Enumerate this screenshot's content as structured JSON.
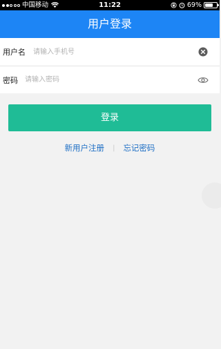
{
  "status_bar": {
    "carrier": "中国移动",
    "time": "11:22",
    "battery": "69%",
    "battery_level": 0.69,
    "icons": [
      "signal-dots",
      "wifi-icon",
      "rotation-lock-icon",
      "alarm-icon",
      "battery-icon"
    ]
  },
  "header": {
    "title": "用户登录"
  },
  "form": {
    "username": {
      "label": "用户名",
      "placeholder": "请输入手机号",
      "value": "",
      "trailing_icon": "clear-icon"
    },
    "password": {
      "label": "密码",
      "placeholder": "请输入密码",
      "value": "",
      "trailing_icon": "eye-icon"
    }
  },
  "login_button": {
    "label": "登录",
    "color": "#1fbc96"
  },
  "links": {
    "register": "新用户注册",
    "separator": "|",
    "forgot": "忘记密码"
  },
  "colors": {
    "header": "#1d85f5",
    "link": "#1e6fc5",
    "background": "#f2f2f2"
  }
}
